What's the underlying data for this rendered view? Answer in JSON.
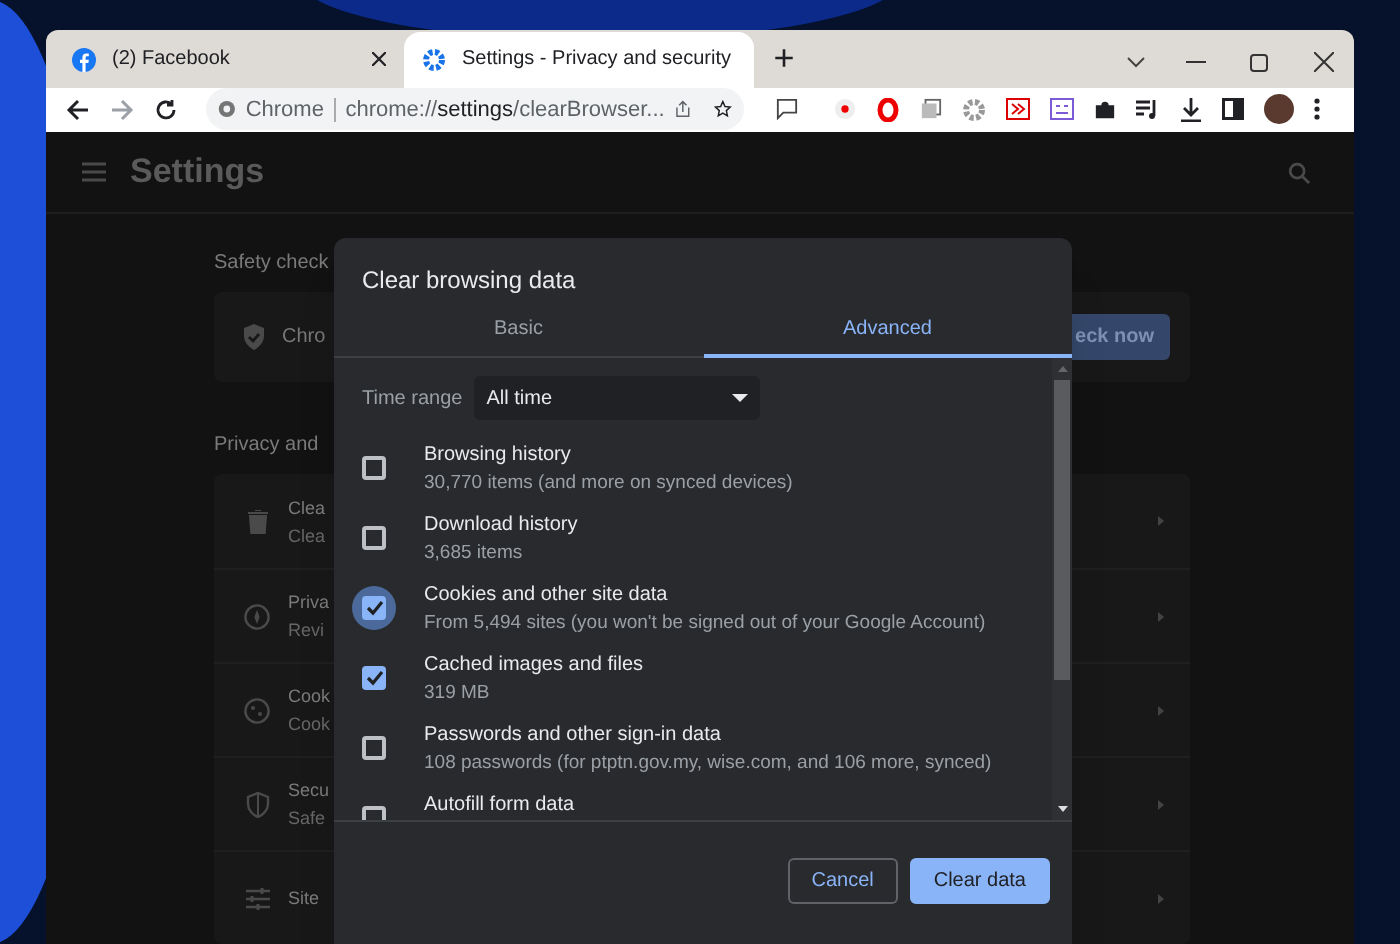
{
  "browser": {
    "tabs": [
      {
        "title": "(2) Facebook",
        "selected": false
      },
      {
        "title": "Settings - Privacy and security",
        "selected": true
      }
    ],
    "new_tab": "+",
    "omnibox": {
      "chip": "Chrome",
      "url": "chrome://**settings**/clearBrowser..."
    }
  },
  "settings": {
    "title": "Settings",
    "safety_check": {
      "heading": "Safety check",
      "card_text": "Chro",
      "button": "eck now"
    },
    "privacy": {
      "heading": "Privacy and",
      "rows": [
        {
          "title": "Clea",
          "subtitle": "Clea"
        },
        {
          "title": "Priva",
          "subtitle": "Revi"
        },
        {
          "title": "Cook",
          "subtitle": "Cook"
        },
        {
          "title": "Secu",
          "subtitle": "Safe"
        },
        {
          "title": "Site"
        }
      ]
    }
  },
  "dialog": {
    "title": "Clear browsing data",
    "tabs": [
      {
        "label": "Basic",
        "selected": false
      },
      {
        "label": "Advanced",
        "selected": true
      }
    ],
    "time_range": {
      "label": "Time range",
      "value": "All time"
    },
    "items": [
      {
        "title": "Browsing history",
        "subtitle": "30,770 items (and more on synced devices)",
        "checked": false,
        "focused": false
      },
      {
        "title": "Download history",
        "subtitle": "3,685 items",
        "checked": false,
        "focused": false
      },
      {
        "title": "Cookies and other site data",
        "subtitle": "From 5,494 sites (you won't be signed out of your Google Account)",
        "checked": true,
        "focused": true
      },
      {
        "title": "Cached images and files",
        "subtitle": "319 MB",
        "checked": true,
        "focused": false
      },
      {
        "title": "Passwords and other sign-in data",
        "subtitle": "108 passwords (for ptptn.gov.my, wise.com, and 106 more, synced)",
        "checked": false,
        "focused": false
      },
      {
        "title": "Autofill form data",
        "checked": false,
        "focused": false
      }
    ],
    "buttons": [
      {
        "label": "Cancel",
        "kind": "secondary"
      },
      {
        "label": "Clear data",
        "kind": "primary"
      }
    ]
  }
}
